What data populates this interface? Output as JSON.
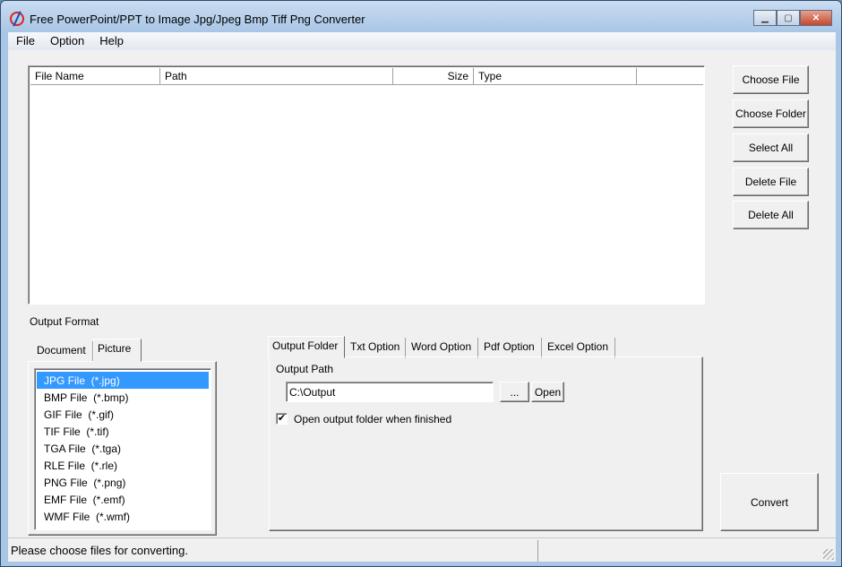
{
  "window": {
    "title": "Free PowerPoint/PPT to Image Jpg/Jpeg Bmp Tiff Png Converter"
  },
  "menu": [
    "File",
    "Option",
    "Help"
  ],
  "file_list": {
    "columns": [
      "File Name",
      "Path",
      "Size",
      "Type"
    ],
    "rows": []
  },
  "side_buttons": [
    "Choose File",
    "Choose Folder",
    "Select All",
    "Delete File",
    "Delete All"
  ],
  "output_format_label": "Output Format",
  "format_tabs": [
    {
      "label": "Document",
      "selected": false
    },
    {
      "label": "Picture",
      "selected": true
    }
  ],
  "formats": [
    "JPG File  (*.jpg)",
    "BMP File  (*.bmp)",
    "GIF File  (*.gif)",
    "TIF File  (*.tif)",
    "TGA File  (*.tga)",
    "RLE File  (*.rle)",
    "PNG File  (*.png)",
    "EMF File  (*.emf)",
    "WMF File  (*.wmf)"
  ],
  "selected_format": 0,
  "option_tabs": [
    {
      "label": "Output Folder",
      "selected": true
    },
    {
      "label": "Txt Option"
    },
    {
      "label": "Word Option"
    },
    {
      "label": "Pdf Option"
    },
    {
      "label": "Excel Option"
    }
  ],
  "output": {
    "path_label": "Output Path",
    "path_value": "C:\\Output",
    "browse_label": "...",
    "open_label": "Open",
    "open_when_finished_label": "Open output folder when finished",
    "open_when_finished": true
  },
  "convert_label": "Convert",
  "status": {
    "message": "Please choose files for converting.",
    "secondary": ""
  }
}
